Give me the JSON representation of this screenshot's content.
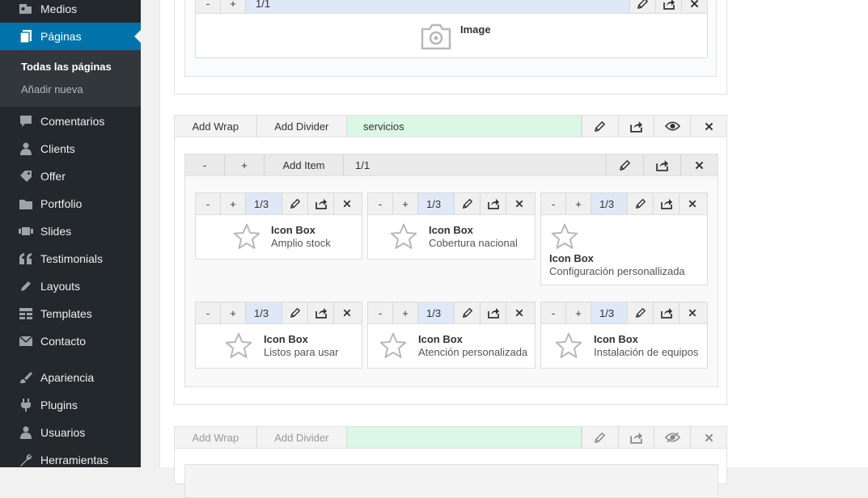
{
  "sidebar": {
    "items": [
      {
        "label": "Medios",
        "icon": "media-icon"
      },
      {
        "label": "Páginas",
        "icon": "pages-icon"
      },
      {
        "label": "Comentarios",
        "icon": "comments-icon"
      },
      {
        "label": "Clients",
        "icon": "user-icon"
      },
      {
        "label": "Offer",
        "icon": "tag-icon"
      },
      {
        "label": "Portfolio",
        "icon": "folder-icon"
      },
      {
        "label": "Slides",
        "icon": "slides-icon"
      },
      {
        "label": "Testimonials",
        "icon": "quote-icon"
      },
      {
        "label": "Layouts",
        "icon": "pencil-icon"
      },
      {
        "label": "Templates",
        "icon": "grid-icon"
      },
      {
        "label": "Contacto",
        "icon": "mail-icon"
      },
      {
        "label": "Apariencia",
        "icon": "brush-icon"
      },
      {
        "label": "Plugins",
        "icon": "plug-icon"
      },
      {
        "label": "Usuarios",
        "icon": "user-icon"
      },
      {
        "label": "Herramientas",
        "icon": "wrench-icon"
      }
    ],
    "submenu": [
      {
        "label": "Todas las páginas"
      },
      {
        "label": "Añadir nueva"
      }
    ]
  },
  "top_section": {
    "minus": "-",
    "plus": "+",
    "size": "1/1",
    "image_label": "Image"
  },
  "wrap_main": {
    "add_wrap": "Add Wrap",
    "add_divider": "Add Divider",
    "name": "servicios",
    "inner": {
      "minus": "-",
      "plus": "+",
      "add_item": "Add Item",
      "size": "1/1"
    },
    "items": [
      {
        "minus": "-",
        "plus": "+",
        "size": "1/3",
        "title": "Icon Box",
        "desc": "Amplio stock"
      },
      {
        "minus": "-",
        "plus": "+",
        "size": "1/3",
        "title": "Icon Box",
        "desc": "Cobertura nacional"
      },
      {
        "minus": "-",
        "plus": "+",
        "size": "1/3",
        "title": "Icon Box",
        "desc": "Configuración personallizada"
      },
      {
        "minus": "-",
        "plus": "+",
        "size": "1/3",
        "title": "Icon Box",
        "desc": "Listos para usar"
      },
      {
        "minus": "-",
        "plus": "+",
        "size": "1/3",
        "title": "Icon Box",
        "desc": "Atención personalizada"
      },
      {
        "minus": "-",
        "plus": "+",
        "size": "1/3",
        "title": "Icon Box",
        "desc": "Instalación de equipos"
      }
    ]
  },
  "wrap_bottom": {
    "add_wrap": "Add Wrap",
    "add_divider": "Add Divider"
  },
  "colors": {
    "sidebar_bg": "#23282d",
    "accent": "#0073aa",
    "label_bg": "#dbf7e6",
    "size_bg": "#dfe8f7"
  }
}
